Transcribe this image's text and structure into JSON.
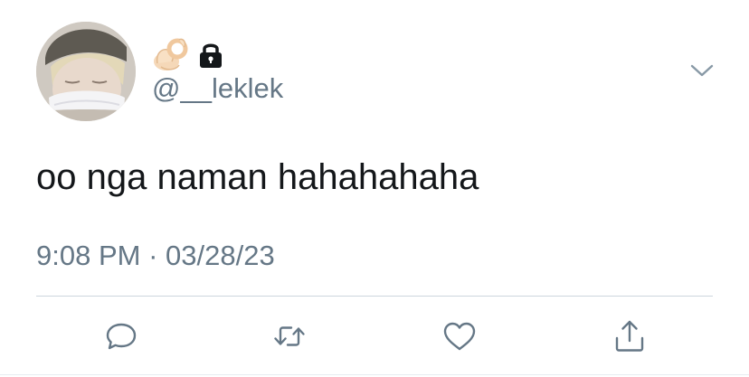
{
  "user": {
    "display_name_emoji": "ok-hand-emoji",
    "protected": true,
    "handle": "@__leklek"
  },
  "tweet": {
    "text": "oo nga naman hahahahaha",
    "time": "9:08 PM",
    "separator": "·",
    "date": "03/28/23"
  },
  "icons": {
    "reply": "reply-icon",
    "retweet": "retweet-icon",
    "like": "like-icon",
    "share": "share-icon",
    "menu": "chevron-down-icon"
  },
  "colors": {
    "text": "#14171a",
    "secondary": "#657786",
    "divider": "#ccd6dd"
  }
}
